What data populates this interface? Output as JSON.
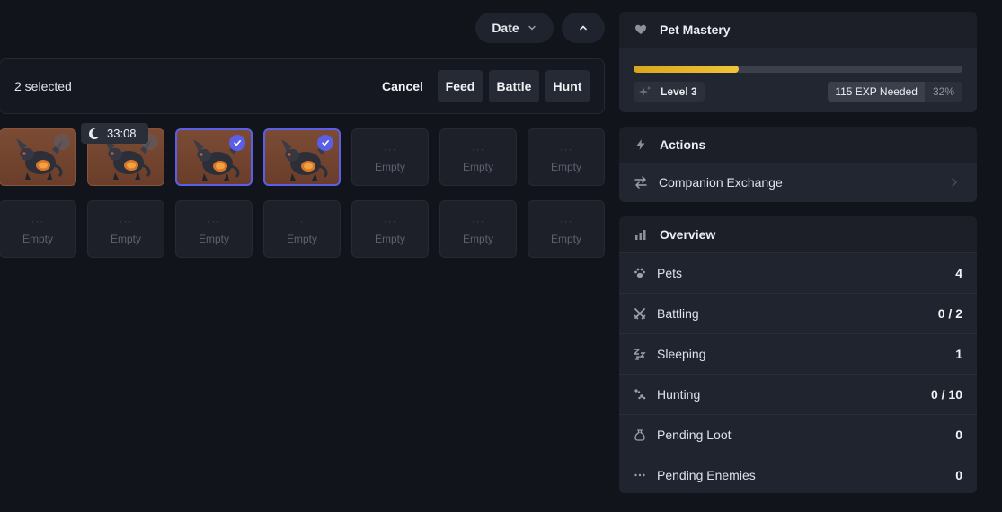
{
  "sort": {
    "field": "Date",
    "direction_icon": "chevron-up-icon"
  },
  "selection": {
    "count_label": "2 selected",
    "buttons": {
      "cancel": "Cancel",
      "feed": "Feed",
      "battle": "Battle",
      "hunt": "Hunt"
    }
  },
  "grid": {
    "timer": "33:08",
    "empty_label": "Empty",
    "empty_dots": "···",
    "slots": [
      {
        "type": "pet",
        "selected": false
      },
      {
        "type": "pet",
        "selected": false,
        "sleeping": true
      },
      {
        "type": "pet",
        "selected": true
      },
      {
        "type": "pet",
        "selected": true
      },
      {
        "type": "empty"
      },
      {
        "type": "empty"
      },
      {
        "type": "empty"
      },
      {
        "type": "empty"
      },
      {
        "type": "empty"
      },
      {
        "type": "empty"
      },
      {
        "type": "empty"
      },
      {
        "type": "empty"
      },
      {
        "type": "empty"
      },
      {
        "type": "empty"
      }
    ]
  },
  "mastery": {
    "title": "Pet Mastery",
    "level": "Level 3",
    "exp_needed": "115 EXP Needed",
    "percent": "32%",
    "progress": 0.32,
    "bar_color": "#e2b02a"
  },
  "actions": {
    "title": "Actions",
    "items": [
      {
        "label": "Companion Exchange"
      }
    ]
  },
  "overview": {
    "title": "Overview",
    "rows": [
      {
        "label": "Pets",
        "value": "4",
        "icon": "paw-icon"
      },
      {
        "label": "Battling",
        "value": "0 / 2",
        "icon": "swords-icon"
      },
      {
        "label": "Sleeping",
        "value": "1",
        "icon": "zzz-icon"
      },
      {
        "label": "Hunting",
        "value": "0 / 10",
        "icon": "pawprints-icon"
      },
      {
        "label": "Pending Loot",
        "value": "0",
        "icon": "loot-bag-icon"
      },
      {
        "label": "Pending Enemies",
        "value": "0",
        "icon": "dots-icon"
      }
    ]
  },
  "colors": {
    "accent": "#5b5ee6",
    "background": "#12141b",
    "panel": "#1c1f28"
  }
}
